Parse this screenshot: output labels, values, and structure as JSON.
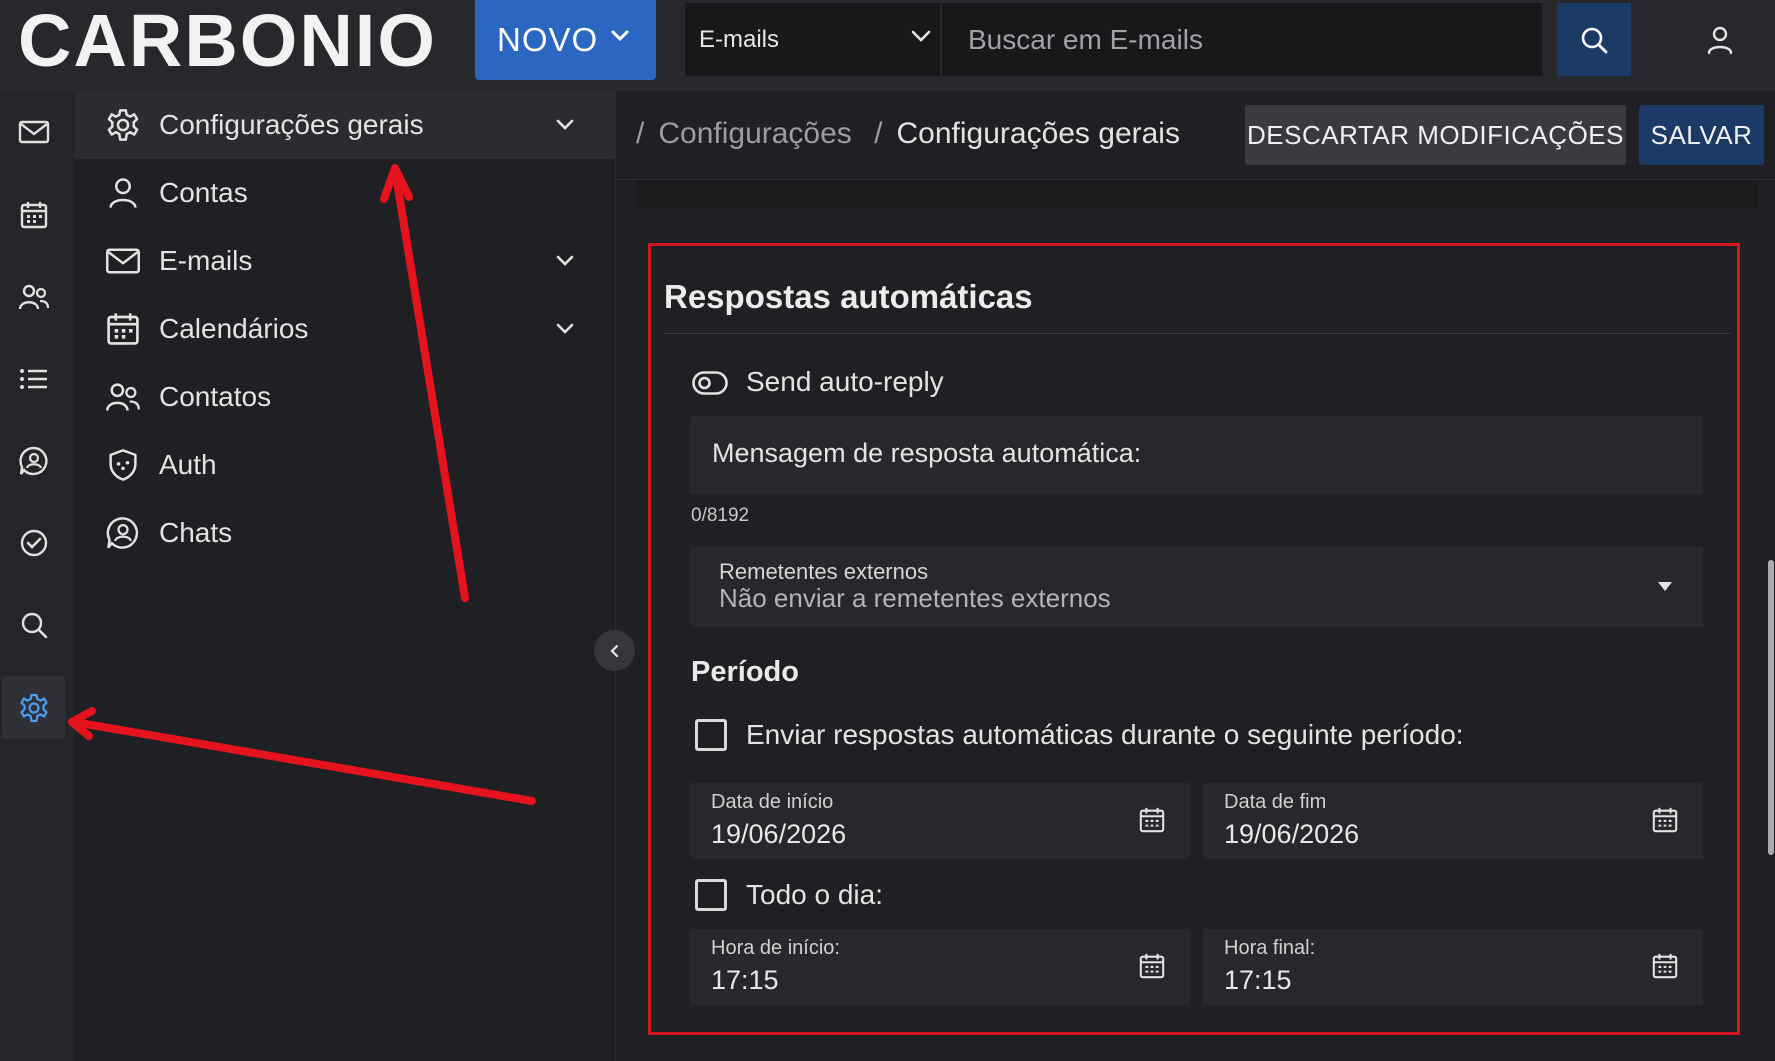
{
  "app": {
    "logo_text": "CARBONIO"
  },
  "topbar": {
    "new_button_label": "NOVO",
    "module_select_value": "E-mails",
    "search_placeholder": "Buscar em E-mails"
  },
  "rail": {
    "items": [
      {
        "icon": "mail-icon"
      },
      {
        "icon": "calendar-icon"
      },
      {
        "icon": "contacts-icon"
      },
      {
        "icon": "list-icon"
      },
      {
        "icon": "chats-icon"
      },
      {
        "icon": "tasks-icon"
      },
      {
        "icon": "search-icon"
      },
      {
        "icon": "settings-icon",
        "active": true
      }
    ]
  },
  "sidebar": {
    "items": [
      {
        "label": "Configurações gerais",
        "icon": "gear-icon",
        "expandable": true,
        "active": true
      },
      {
        "label": "Contas",
        "icon": "person-icon"
      },
      {
        "label": "E-mails",
        "icon": "mail-icon",
        "expandable": true
      },
      {
        "label": "Calendários",
        "icon": "calendar-icon",
        "expandable": true
      },
      {
        "label": "Contatos",
        "icon": "contacts-icon"
      },
      {
        "label": "Auth",
        "icon": "shield-icon"
      },
      {
        "label": "Chats",
        "icon": "chats-icon"
      }
    ]
  },
  "header": {
    "breadcrumb": [
      "Configurações",
      "Configurações gerais"
    ],
    "breadcrumb_sep": "/",
    "discard_label": "DESCARTAR MODIFICAÇÕES",
    "save_label": "SALVAR"
  },
  "auto_reply": {
    "title": "Respostas automáticas",
    "toggle_label": "Send auto-reply",
    "toggle_on": false,
    "message_placeholder": "Mensagem de resposta automática:",
    "counter": "0/8192",
    "external_label": "Remetentes externos",
    "external_value": "Não enviar a remetentes externos",
    "period_title": "Período",
    "period_checkbox_label": "Enviar respostas automáticas durante o seguinte período:",
    "start_date_label": "Data de início",
    "start_date_value": "19/06/2026",
    "end_date_label": "Data de fim",
    "end_date_value": "19/06/2026",
    "all_day_label": "Todo o dia:",
    "start_time_label": "Hora de início:",
    "start_time_value": "17:15",
    "end_time_label": "Hora final:",
    "end_time_value": "17:15"
  },
  "colors": {
    "accent": "#2b67c0",
    "save_button": "#1b3a66",
    "highlight_border": "#d0161f",
    "annotation_arrow": "#e5131d"
  }
}
